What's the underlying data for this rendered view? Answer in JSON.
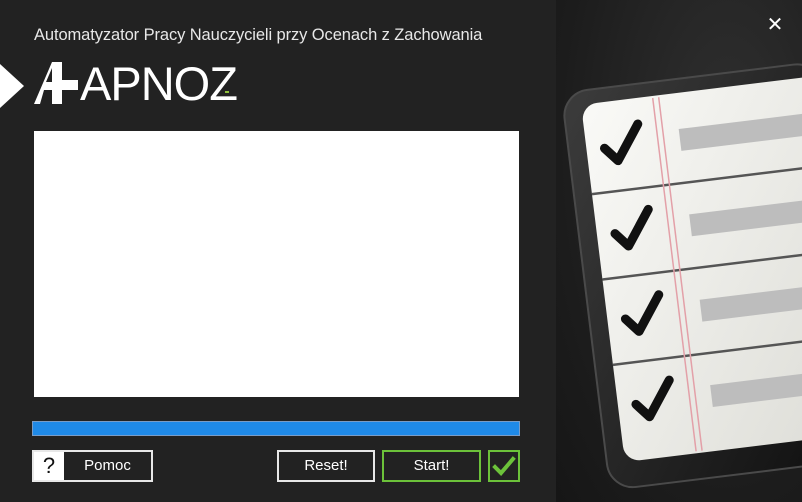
{
  "window": {
    "title": "Automatyzator Pracy Nauczycieli przy Ocenach z Zachowania",
    "close_glyph": "✕"
  },
  "logo": {
    "text": "APNOZ",
    "accent_color": "#8fc13a"
  },
  "output": {
    "value": ""
  },
  "progress": {
    "fraction": 1.0,
    "color": "#1f8ae8"
  },
  "buttons": {
    "help_icon": "?",
    "help_label": "Pomoc",
    "reset_label": "Reset!",
    "start_label": "Start!",
    "confirm_icon": "checkmark-icon"
  },
  "colors": {
    "accent_green": "#6cc23a",
    "panel": "#222222"
  },
  "illustration": {
    "icon": "checklist-illustration",
    "rows": 4
  }
}
